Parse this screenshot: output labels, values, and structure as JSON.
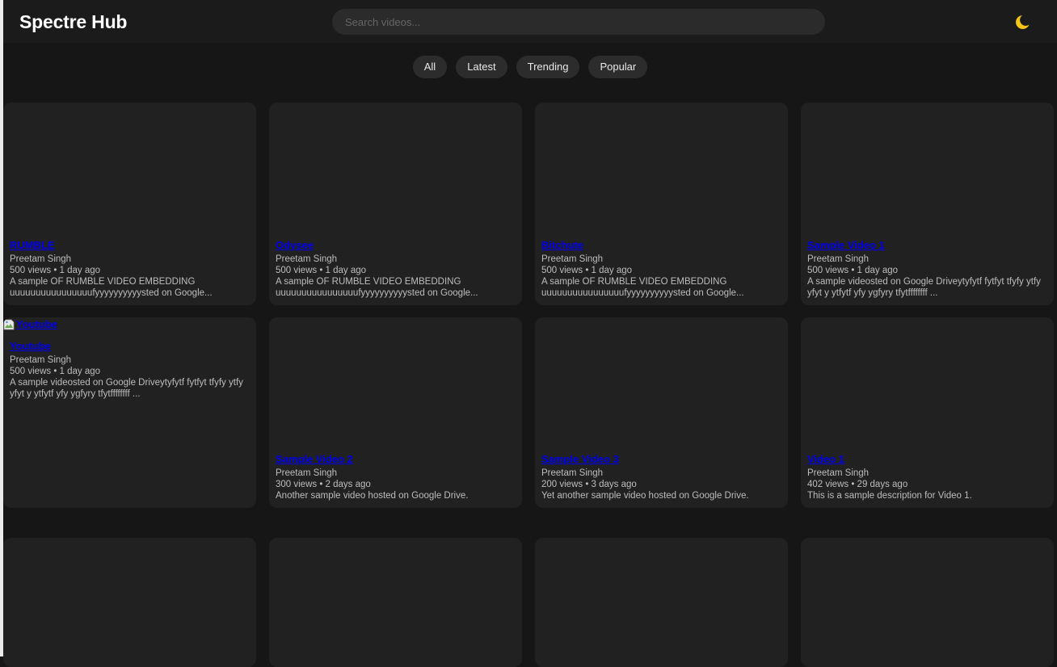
{
  "header": {
    "logo": "Spectre Hub",
    "search_placeholder": "Search videos...",
    "theme_icon": "moon-icon"
  },
  "filters": [
    "All",
    "Latest",
    "Trending",
    "Popular"
  ],
  "videos": [
    {
      "title": "RUMBLE",
      "author": "Preetam Singh",
      "meta": "500 views • 1 day ago",
      "description": "A sample OF RUMBLE VIDEO EMBEDDING uuuuuuuuuuuuuuuufyyyyyyyyyysted on Google..."
    },
    {
      "title": "Odysee",
      "author": "Preetam Singh",
      "meta": "500 views • 1 day ago",
      "description": "A sample OF RUMBLE VIDEO EMBEDDING uuuuuuuuuuuuuuuufyyyyyyyyyysted on Google..."
    },
    {
      "title": "Bitchute",
      "author": "Preetam Singh",
      "meta": "500 views • 1 day ago",
      "description": "A sample OF RUMBLE VIDEO EMBEDDING uuuuuuuuuuuuuuuufyyyyyyyyyysted on Google..."
    },
    {
      "title": "Sample Video 1",
      "author": "Preetam Singh",
      "meta": "500 views • 1 day ago",
      "description": "A sample videosted on Google Driveytyfytf fytfyt tfyfy ytfy yfyt y ytfytf yfy ygfyry tfytffffffff ..."
    },
    {
      "title": "Youtube",
      "thumb_alt": "Youtube",
      "author": "Preetam Singh",
      "meta": "500 views • 1 day ago",
      "description": "A sample videosted on Google Driveytyfytf fytfyt tfyfy ytfy yfyt y ytfytf yfy ygfyry tfytffffffff ..."
    },
    {
      "title": "Sample Video 2",
      "author": "Preetam Singh",
      "meta": "300 views • 2 days ago",
      "description": "Another sample video hosted on Google Drive."
    },
    {
      "title": "Sample Video 3",
      "author": "Preetam Singh",
      "meta": "200 views • 3 days ago",
      "description": "Yet another sample video hosted on Google Drive."
    },
    {
      "title": "Video 1",
      "author": "Preetam Singh",
      "meta": "402 views • 29 days ago",
      "description": "This is a sample description for Video 1."
    }
  ]
}
